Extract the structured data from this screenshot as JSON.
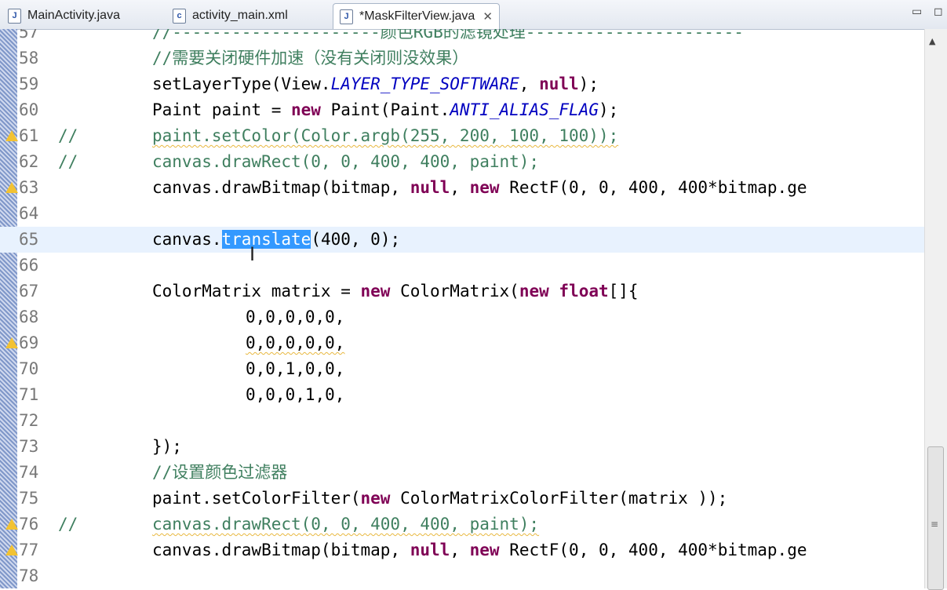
{
  "tabs": [
    {
      "label": "MainActivity.java",
      "icon": "java-file-icon",
      "active": false
    },
    {
      "label": "activity_main.xml",
      "icon": "xml-file-icon",
      "active": false
    },
    {
      "label": "*MaskFilterView.java",
      "icon": "java-file-icon",
      "active": true,
      "close": "✕"
    }
  ],
  "window_controls": {
    "minimize": "▭",
    "maximize": "◻"
  },
  "editor": {
    "lines": [
      {
        "num": "57",
        "warn": false,
        "comment_prefix": "",
        "text": "//---------------------颜色RGB的滤镜处理----------------------"
      },
      {
        "num": "58",
        "warn": false,
        "comment_prefix": "",
        "text": "//需要关闭硬件加速（没有关闭则没效果）"
      },
      {
        "num": "59",
        "warn": false,
        "comment_prefix": "",
        "text": "setLayerType(View.LAYER_TYPE_SOFTWARE, null);"
      },
      {
        "num": "60",
        "warn": false,
        "comment_prefix": "",
        "text": "Paint paint = new Paint(Paint.ANTI_ALIAS_FLAG);"
      },
      {
        "num": "61",
        "warn": true,
        "comment_prefix": "//",
        "text": "paint.setColor(Color.argb(255, 200, 100, 100));"
      },
      {
        "num": "62",
        "warn": false,
        "comment_prefix": "//",
        "text": "canvas.drawRect(0, 0, 400, 400, paint);"
      },
      {
        "num": "63",
        "warn": true,
        "comment_prefix": "",
        "text": "canvas.drawBitmap(bitmap, null, new RectF(0, 0, 400, 400*bitmap.ge"
      },
      {
        "num": "64",
        "warn": false,
        "comment_prefix": "",
        "text": ""
      },
      {
        "num": "65",
        "warn": false,
        "comment_prefix": "",
        "text": "canvas.translate(400, 0);"
      },
      {
        "num": "66",
        "warn": false,
        "comment_prefix": "",
        "text": ""
      },
      {
        "num": "67",
        "warn": false,
        "comment_prefix": "",
        "text": "ColorMatrix matrix = new ColorMatrix(new float[]{"
      },
      {
        "num": "68",
        "warn": false,
        "comment_prefix": "",
        "text": "0,0,0,0,0,"
      },
      {
        "num": "69",
        "warn": true,
        "comment_prefix": "",
        "text": "0,0,0,0,0,"
      },
      {
        "num": "70",
        "warn": false,
        "comment_prefix": "",
        "text": "0,0,1,0,0,"
      },
      {
        "num": "71",
        "warn": false,
        "comment_prefix": "",
        "text": "0,0,0,1,0,"
      },
      {
        "num": "72",
        "warn": false,
        "comment_prefix": "",
        "text": ""
      },
      {
        "num": "73",
        "warn": false,
        "comment_prefix": "",
        "text": "});"
      },
      {
        "num": "74",
        "warn": false,
        "comment_prefix": "",
        "text": "//设置颜色过滤器"
      },
      {
        "num": "75",
        "warn": false,
        "comment_prefix": "",
        "text": "paint.setColorFilter(new ColorMatrixColorFilter(matrix ));"
      },
      {
        "num": "76",
        "warn": true,
        "comment_prefix": "//",
        "text": "canvas.drawRect(0, 0, 400, 400, paint);"
      },
      {
        "num": "77",
        "warn": true,
        "comment_prefix": "",
        "text": "canvas.drawBitmap(bitmap, null, new RectF(0, 0, 400, 400*bitmap.ge"
      },
      {
        "num": "78",
        "warn": false,
        "comment_prefix": "",
        "text": ""
      }
    ],
    "selection": "translate",
    "current_line": "65"
  },
  "scrollbar": {
    "up_arrow": "▲",
    "grip": "≡"
  },
  "cursor_glyph": "I"
}
